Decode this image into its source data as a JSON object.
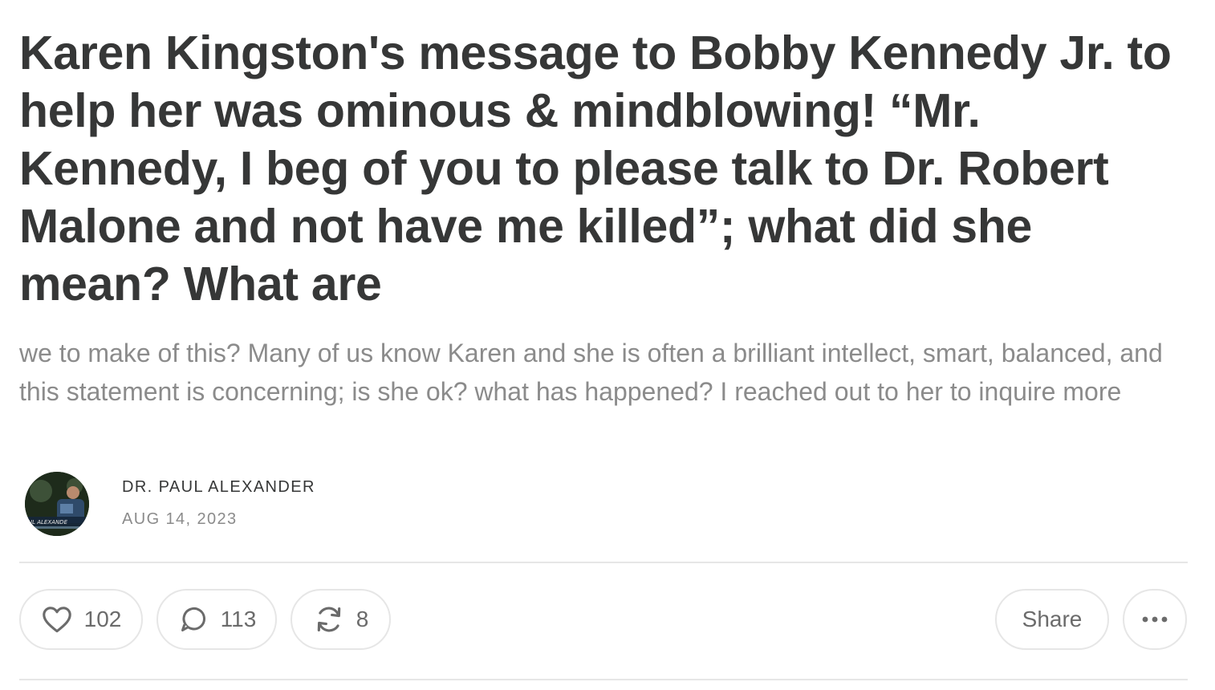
{
  "post": {
    "title": "Karen Kingston's message to Bobby Kennedy Jr. to help her was ominous & mindblowing! “Mr. Kennedy, I beg of you to please talk to Dr. Robert Malone and not have me killed”; what did she mean? What are",
    "subtitle": "we to make of this? Many of us know Karen and she is often a brilliant intellect, smart, balanced, and this statement is concerning; is she ok? what has happened? I reached out to her to inquire more"
  },
  "byline": {
    "author": "DR. PAUL ALEXANDER",
    "date": "AUG 14, 2023",
    "avatar_caption": "UL ALEXANDE"
  },
  "actions": {
    "likes": "102",
    "comments": "113",
    "restacks": "8",
    "share_label": "Share",
    "icons": {
      "like": "heart-icon",
      "comment": "speech-bubble-icon",
      "restack": "restack-arrows-icon",
      "more": "ellipsis-icon"
    }
  },
  "colors": {
    "title": "#363737",
    "subtitle": "#8b8b8b",
    "border": "#e6e6e6",
    "action_text": "#6b6b6b"
  }
}
